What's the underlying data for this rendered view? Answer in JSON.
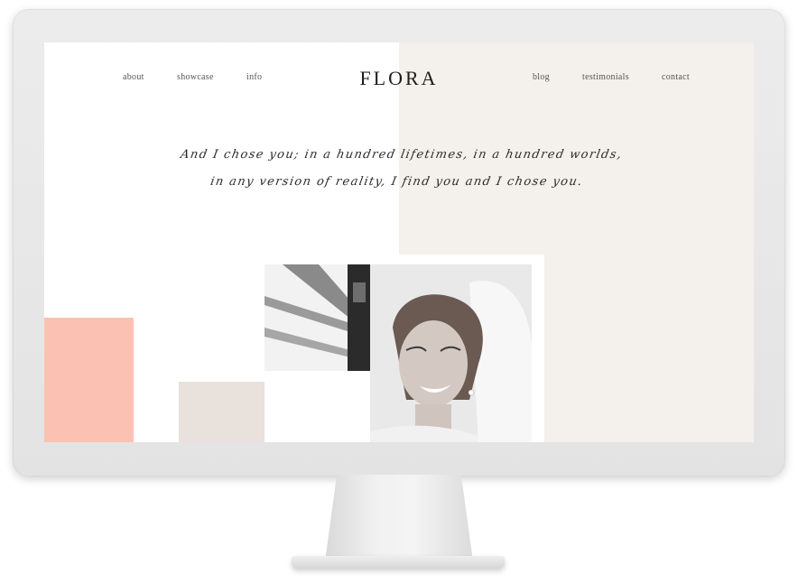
{
  "nav": {
    "left": [
      "about",
      "showcase",
      "info"
    ],
    "right": [
      "blog",
      "testimonials",
      "contact"
    ]
  },
  "logo": "FLORA",
  "quote": {
    "line1": "And I chose you; in a hundred lifetimes, in a hundred worlds,",
    "line2": "in any version of reality, I find you and I chose you."
  },
  "colors": {
    "pink_accent": "#fbc1b3",
    "cream_panel": "#f4f0ec",
    "beige_block": "#e9e1dc"
  }
}
